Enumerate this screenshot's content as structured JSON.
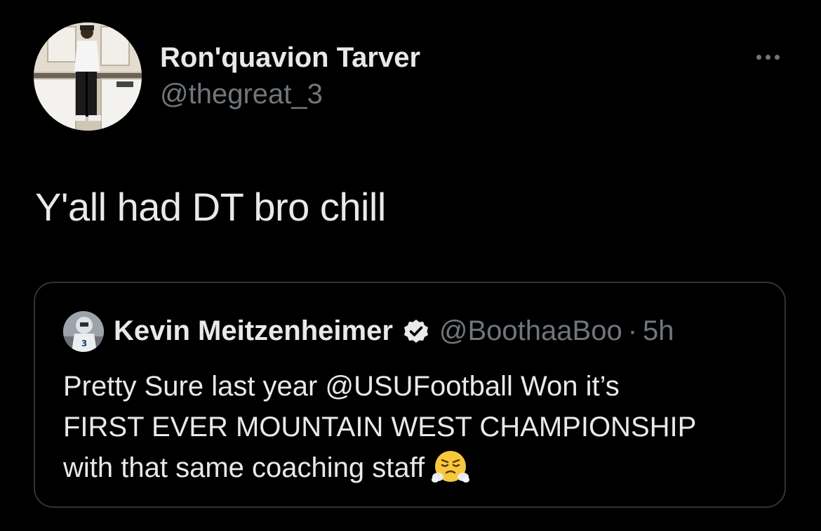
{
  "tweet": {
    "author_name": "Ron'quavion Tarver",
    "author_handle": "@thegreat_3",
    "text": "Y'all had DT bro chill",
    "more_icon": "more-horizontal-icon"
  },
  "quote": {
    "author_name": "Kevin Meitzenheimer",
    "author_handle": "@BoothaaBoo",
    "separator": "·",
    "time": "5h",
    "verified_icon": "verified-badge-icon",
    "text_lines": [
      "Pretty Sure last year @USUFootball Won it’s",
      "FIRST EVER MOUNTAIN WEST CHAMPIONSHIP",
      "with that same coaching staff"
    ],
    "emoji": "face-with-steam-from-nose-icon"
  },
  "colors": {
    "background": "#000000",
    "primary_text": "#e7e9ea",
    "secondary_text": "#71767b",
    "border": "#2f3336"
  }
}
